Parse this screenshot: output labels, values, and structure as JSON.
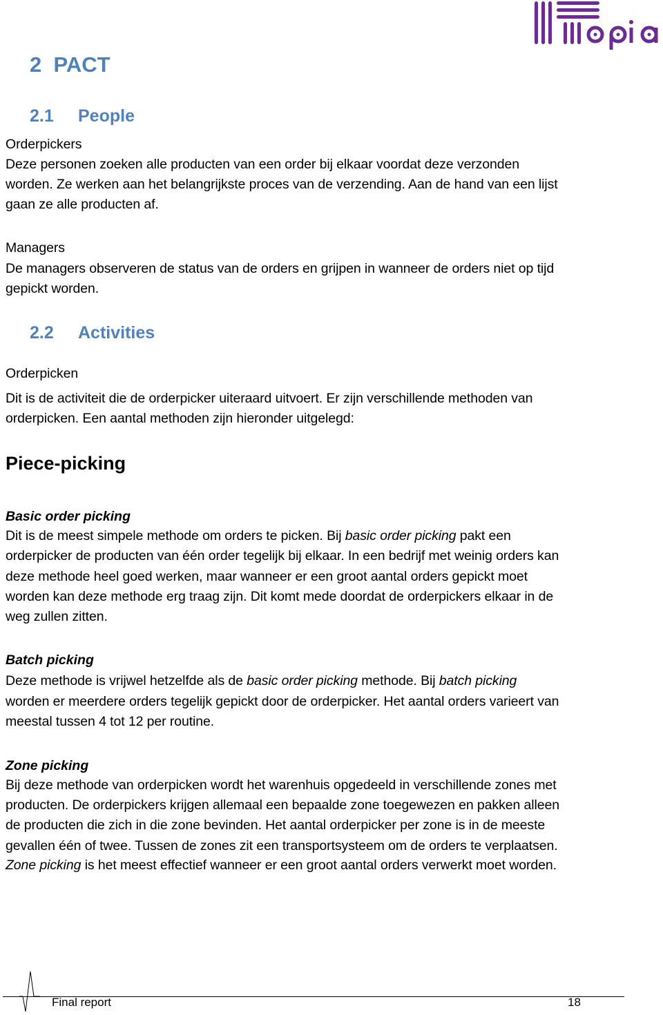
{
  "logo": {
    "text": "opia",
    "color": "#6a2c91"
  },
  "heading1": {
    "number": "2",
    "title": "PACT",
    "color": "#4f81bd"
  },
  "section_people": {
    "number": "2.1",
    "title": "People",
    "roles": [
      {
        "name": "Orderpickers",
        "lines": [
          "Deze personen zoeken alle producten van een order bij elkaar voordat deze verzonden",
          "worden. Ze werken aan het belangrijkste proces van de verzending. Aan de hand van een lijst",
          "gaan ze alle producten af."
        ]
      },
      {
        "name": "Managers",
        "lines": [
          "De managers observeren de status van de orders en grijpen in wanneer de orders niet op tijd",
          "gepickt worden."
        ]
      }
    ]
  },
  "section_activities": {
    "number": "2.2",
    "title": "Activities",
    "activity_name": "Orderpicken",
    "lines": [
      "Dit is de activiteit die de orderpicker uiteraard uitvoert. Er zijn verschillende methoden van",
      "orderpicken. Een aantal methoden zijn hieronder uitgelegd:"
    ],
    "subheading": "Piece-picking",
    "methods": [
      {
        "title": "Basic order picking",
        "line1_pre": "Dit is de meest simpele methode om orders te picken. Bij ",
        "line1_italic": "basic order picking",
        "line1_post": " pakt een",
        "lines": [
          "orderpicker de producten van één order tegelijk bij elkaar. In een bedrijf met weinig orders kan",
          "deze methode heel goed werken, maar wanneer er een groot aantal orders gepickt moet",
          "worden kan deze methode erg traag zijn. Dit komt mede doordat de orderpickers elkaar in de",
          "weg zullen zitten."
        ]
      },
      {
        "title": "Batch picking",
        "line1_a": "Deze methode is vrijwel hetzelfde als de ",
        "line1_italic_a": "basic order picking",
        "line1_b": " methode. Bij ",
        "line1_italic_b": "batch picking",
        "lines": [
          "worden er meerdere orders tegelijk gepickt door de orderpicker. Het aantal orders varieert van",
          "meestal tussen 4 tot 12 per routine."
        ]
      },
      {
        "title": "Zone picking",
        "lines": [
          "Bij deze methode van orderpicken wordt het warenhuis opgedeeld in verschillende zones met",
          "producten. De orderpickers krijgen allemaal een bepaalde zone toegewezen en pakken alleen",
          "de producten die zich in die zone bevinden. Het aantal orderpicker per zone is in de meeste",
          "gevallen één of twee. Tussen de zones zit een transportsysteem om de orders te verplaatsen."
        ],
        "last_italic": "Zone picking",
        "last_post": " is het meest effectief wanneer er een groot aantal orders verwerkt moet worden."
      }
    ]
  },
  "footer": {
    "label": "Final report",
    "page": "18"
  }
}
